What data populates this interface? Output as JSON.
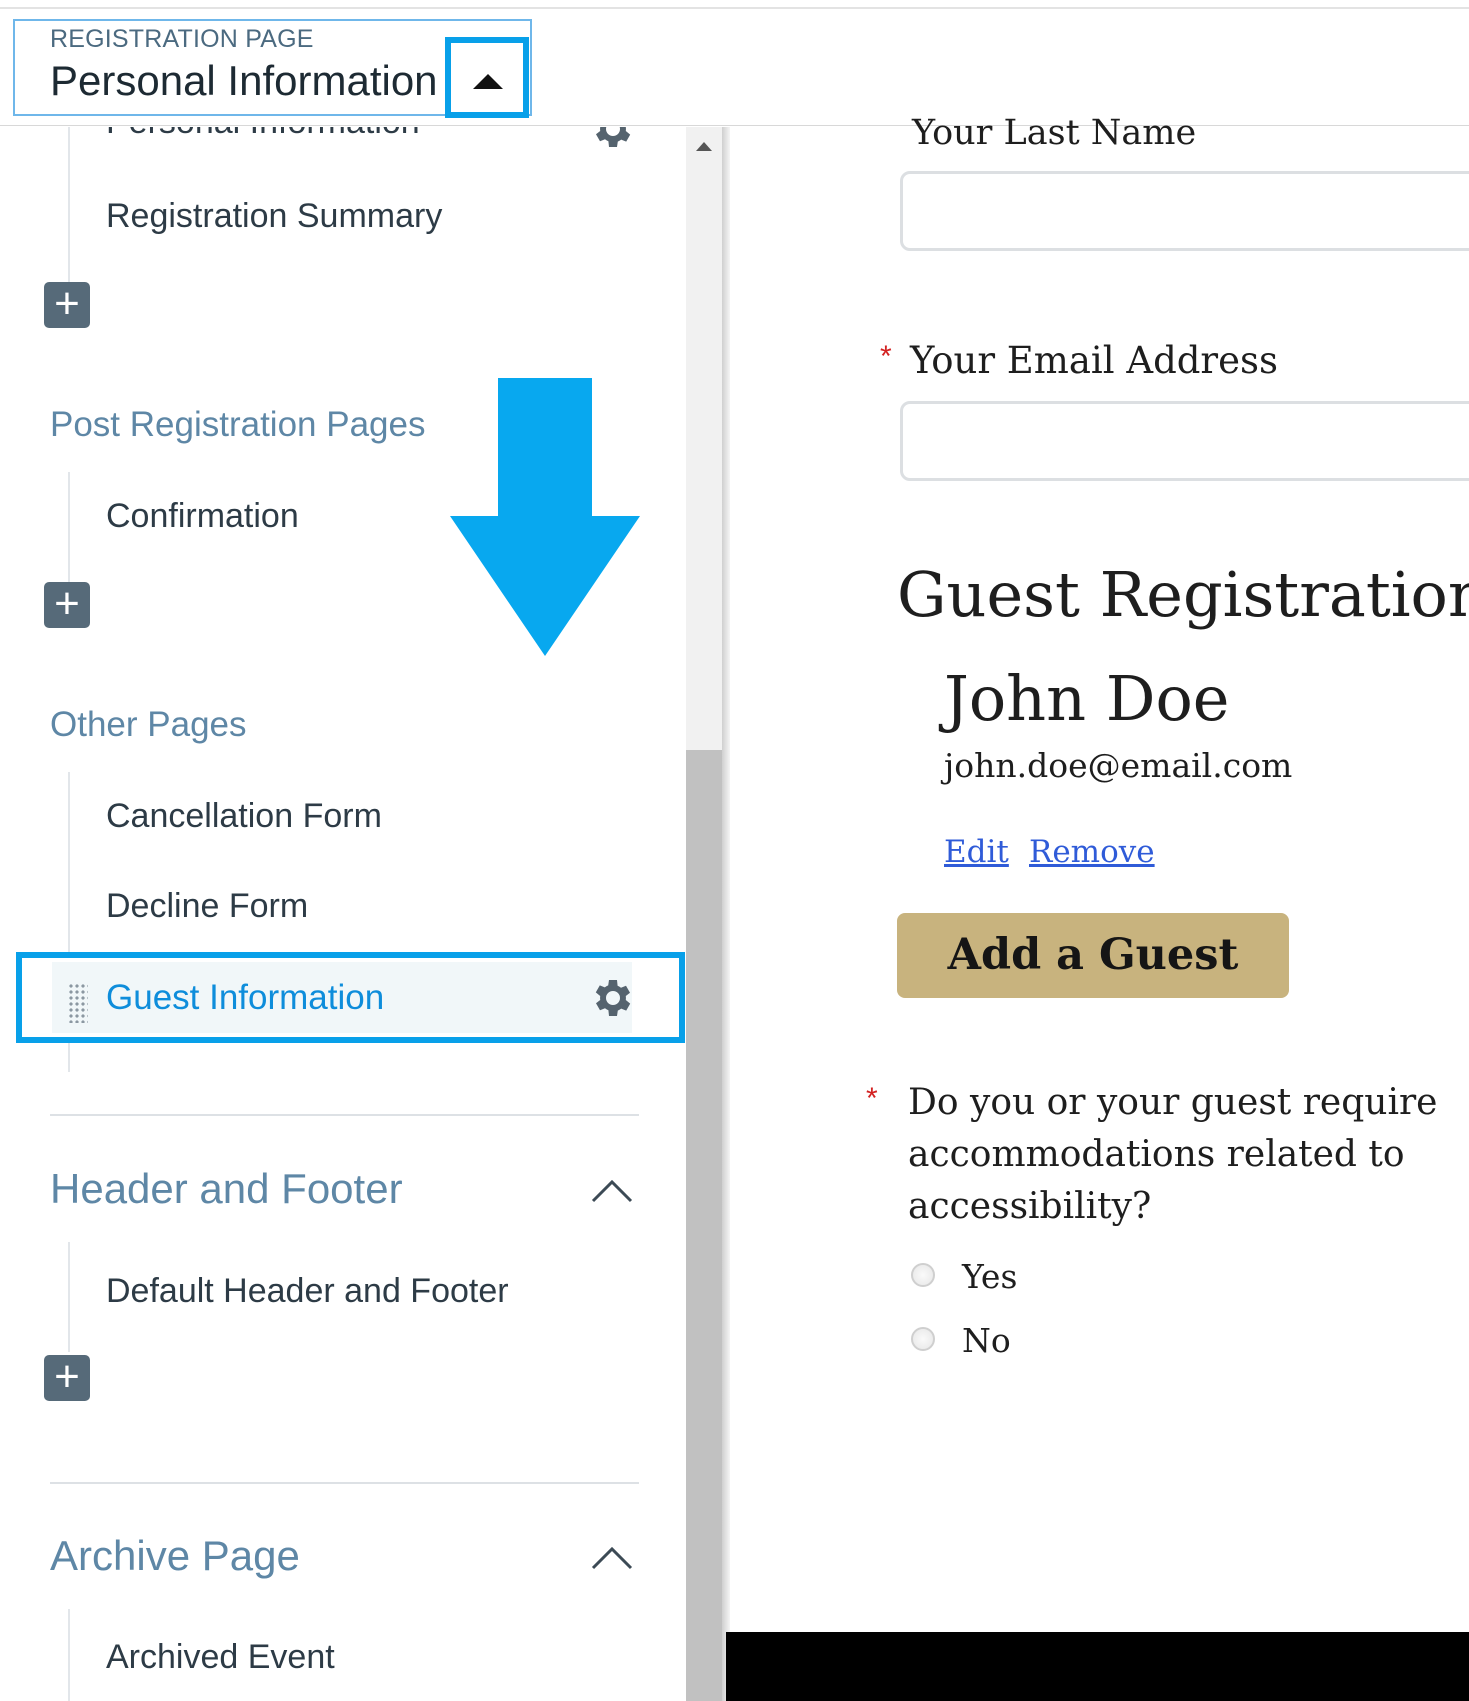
{
  "header": {
    "kicker": "REGISTRATION PAGE",
    "selected_page": "Personal Information"
  },
  "sidebar": {
    "partial_item": "Personal Information",
    "registration_items": [
      "Registration Summary"
    ],
    "post_registration": {
      "label": "Post Registration Pages",
      "items": [
        "Confirmation"
      ]
    },
    "other_pages": {
      "label": "Other Pages",
      "items": [
        "Cancellation Form",
        "Decline Form",
        "Guest Information"
      ]
    },
    "header_footer": {
      "label": "Header and Footer",
      "items": [
        "Default Header and Footer"
      ]
    },
    "archive": {
      "label": "Archive Page",
      "items": [
        "Archived Event"
      ]
    },
    "add_symbol": "+"
  },
  "form": {
    "last_name_label": "Your Last Name",
    "email_label": "Your Email Address",
    "required_mark": "*",
    "guest_heading": "Guest Registration",
    "guest": {
      "name": "John Doe",
      "email": "john.doe@email.com",
      "edit_label": "Edit",
      "remove_label": "Remove"
    },
    "add_guest_label": "Add a Guest",
    "accessibility_question": [
      "Do you or your guest require",
      "accommodations related to",
      "accessibility?"
    ],
    "options": [
      "Yes",
      "No"
    ]
  },
  "colors": {
    "highlight": "#08a0e9",
    "accent_button": "#c8b37e",
    "section_label": "#5e87a6",
    "active_link": "#0e8ddb"
  },
  "icons": [
    "caret-up-icon",
    "gear-icon",
    "plus-icon",
    "chevron-up-icon",
    "drag-handle-icon",
    "down-arrow-icon"
  ]
}
